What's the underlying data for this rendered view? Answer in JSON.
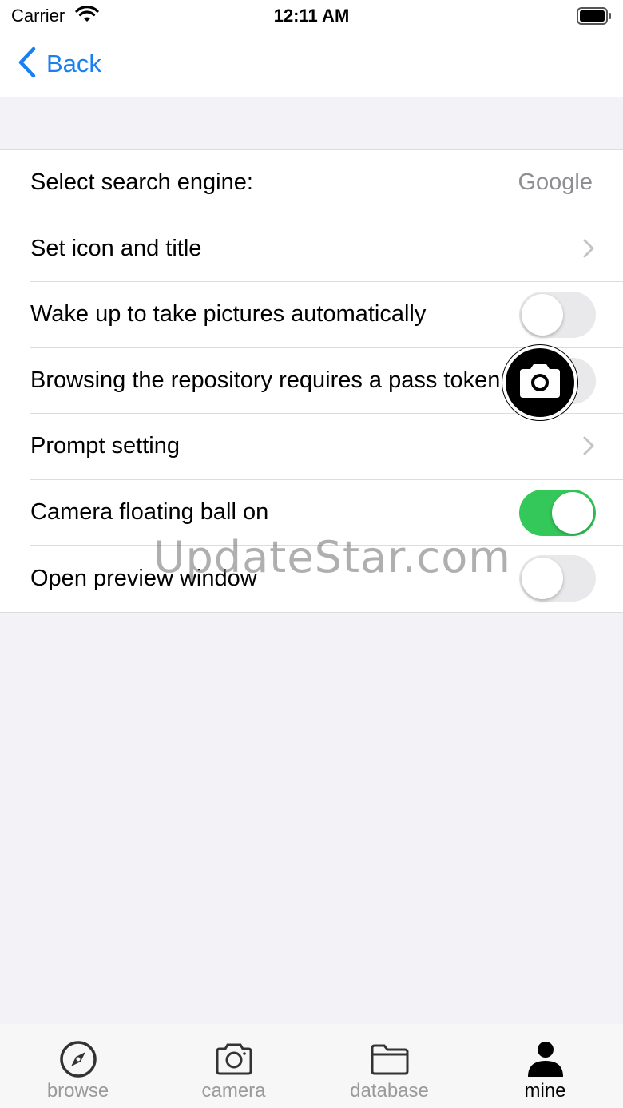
{
  "status_bar": {
    "carrier": "Carrier",
    "time": "12:11 AM"
  },
  "nav": {
    "back_label": "Back"
  },
  "settings": {
    "rows": [
      {
        "label": "Select search engine:",
        "value": "Google",
        "accessory": "value"
      },
      {
        "label": "Set icon and title",
        "accessory": "chevron"
      },
      {
        "label": "Wake up to take pictures automatically",
        "accessory": "switch",
        "on": false
      },
      {
        "label": "Browsing the repository requires a pass token",
        "accessory": "switch",
        "on": false
      },
      {
        "label": "Prompt setting",
        "accessory": "chevron"
      },
      {
        "label": "Camera floating ball on",
        "accessory": "switch",
        "on": true
      },
      {
        "label": "Open preview window",
        "accessory": "switch",
        "on": false
      }
    ]
  },
  "watermark": "UpdateStar.com",
  "tabs": [
    {
      "label": "browse",
      "icon": "compass-icon",
      "active": false
    },
    {
      "label": "camera",
      "icon": "camera-icon",
      "active": false
    },
    {
      "label": "database",
      "icon": "folder-icon",
      "active": false
    },
    {
      "label": "mine",
      "icon": "person-icon",
      "active": true
    }
  ],
  "colors": {
    "accent": "#1a7ff0",
    "switch_on": "#34c759",
    "background": "#f2f2f7"
  }
}
